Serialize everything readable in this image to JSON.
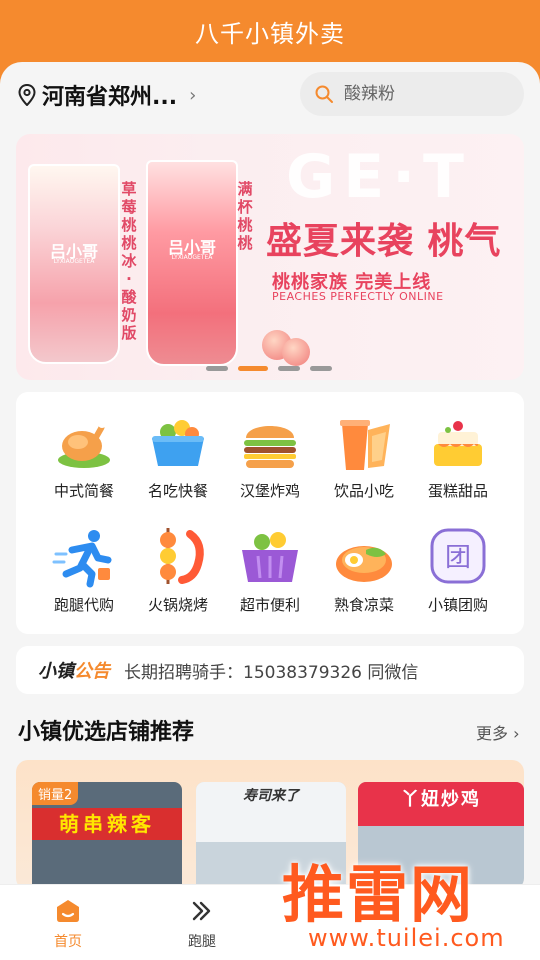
{
  "app": {
    "title": "八千小镇外卖"
  },
  "location": {
    "text": "河南省郑州...",
    "icon": "location-pin-icon"
  },
  "search": {
    "placeholder": "酸辣粉",
    "icon": "search-icon"
  },
  "banner": {
    "headline": "盛夏来袭 桃气",
    "subline": "桃桃家族 完美上线",
    "subline_en": "PEACHES PERFECTLY ONLINE",
    "bg_text": "GE·T",
    "cup1_label": "草莓桃桃冰·酸奶版",
    "cup2_label": "满杯桃桃",
    "cup_logo": "吕小哥",
    "cup_logo_sub": "LYXIAOGETEA",
    "slide_count": 4,
    "active_slide": 1
  },
  "categories": [
    {
      "label": "中式简餐",
      "icon": "roast-chicken-icon"
    },
    {
      "label": "名吃快餐",
      "icon": "food-bowl-icon"
    },
    {
      "label": "汉堡炸鸡",
      "icon": "burger-icon"
    },
    {
      "label": "饮品小吃",
      "icon": "drink-cup-icon"
    },
    {
      "label": "蛋糕甜品",
      "icon": "cake-icon"
    },
    {
      "label": "跑腿代购",
      "icon": "runner-icon"
    },
    {
      "label": "火锅烧烤",
      "icon": "skewer-shrimp-icon"
    },
    {
      "label": "超市便利",
      "icon": "shopping-basket-icon"
    },
    {
      "label": "熟食凉菜",
      "icon": "cold-dish-icon"
    },
    {
      "label": "小镇团购",
      "icon": "group-buy-icon"
    }
  ],
  "notice": {
    "tag_part1": "小镇",
    "tag_part2": "公告",
    "message": "长期招聘骑手：15038379326 同微信"
  },
  "section": {
    "title": "小镇优选店铺推荐",
    "more": "更多"
  },
  "stores": [
    {
      "badge": "销量2",
      "sign": "萌串辣客"
    },
    {
      "sign": "寿司来了"
    },
    {
      "sign": "丫妞炒鸡"
    }
  ],
  "tabs": [
    {
      "label": "首页",
      "icon": "home-icon",
      "active": true
    },
    {
      "label": "跑腿",
      "icon": "errand-icon",
      "active": false
    }
  ],
  "watermark": {
    "text": "推雷网",
    "url": "www.tuilei.com"
  },
  "colors": {
    "accent": "#f58a2e",
    "banner_red": "#e8435e"
  }
}
